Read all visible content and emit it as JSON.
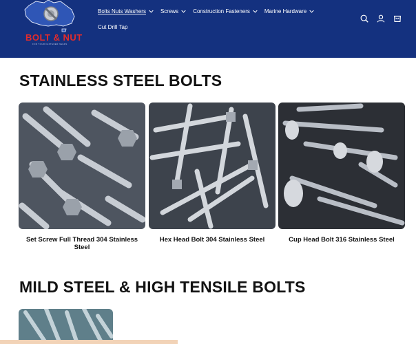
{
  "header": {
    "logo": {
      "text": "BOLT & NUT",
      "tagline": "FOR YOUR FASTENER NEEDS"
    },
    "nav": [
      {
        "label": "Bolts Nuts Washers",
        "active": true,
        "has_dropdown": true
      },
      {
        "label": "Screws",
        "active": false,
        "has_dropdown": true
      },
      {
        "label": "Construction Fasteners",
        "active": false,
        "has_dropdown": true
      },
      {
        "label": "Marine Hardware",
        "active": false,
        "has_dropdown": true
      },
      {
        "label": "Cut Drill Tap",
        "active": false,
        "has_dropdown": false
      }
    ],
    "icons": [
      "search-icon",
      "account-icon",
      "cart-icon"
    ]
  },
  "sections": [
    {
      "title": "STAINLESS STEEL BOLTS",
      "products": [
        {
          "title": "Set Screw Full Thread 304 Stainless Steel",
          "image": "set-screw-photo"
        },
        {
          "title": "Hex Head Bolt 304 Stainless Steel",
          "image": "hex-bolt-photo"
        },
        {
          "title": "Cup Head Bolt 316 Stainless Steel",
          "image": "cup-head-bolt-photo"
        }
      ]
    },
    {
      "title": "MILD STEEL & HIGH TENSILE BOLTS",
      "products": [
        {
          "title": "",
          "image": "mild-steel-bolt-photo"
        }
      ]
    }
  ],
  "colors": {
    "header_bg": "#14317f",
    "logo_red": "#e42b2b",
    "text": "#121212"
  }
}
